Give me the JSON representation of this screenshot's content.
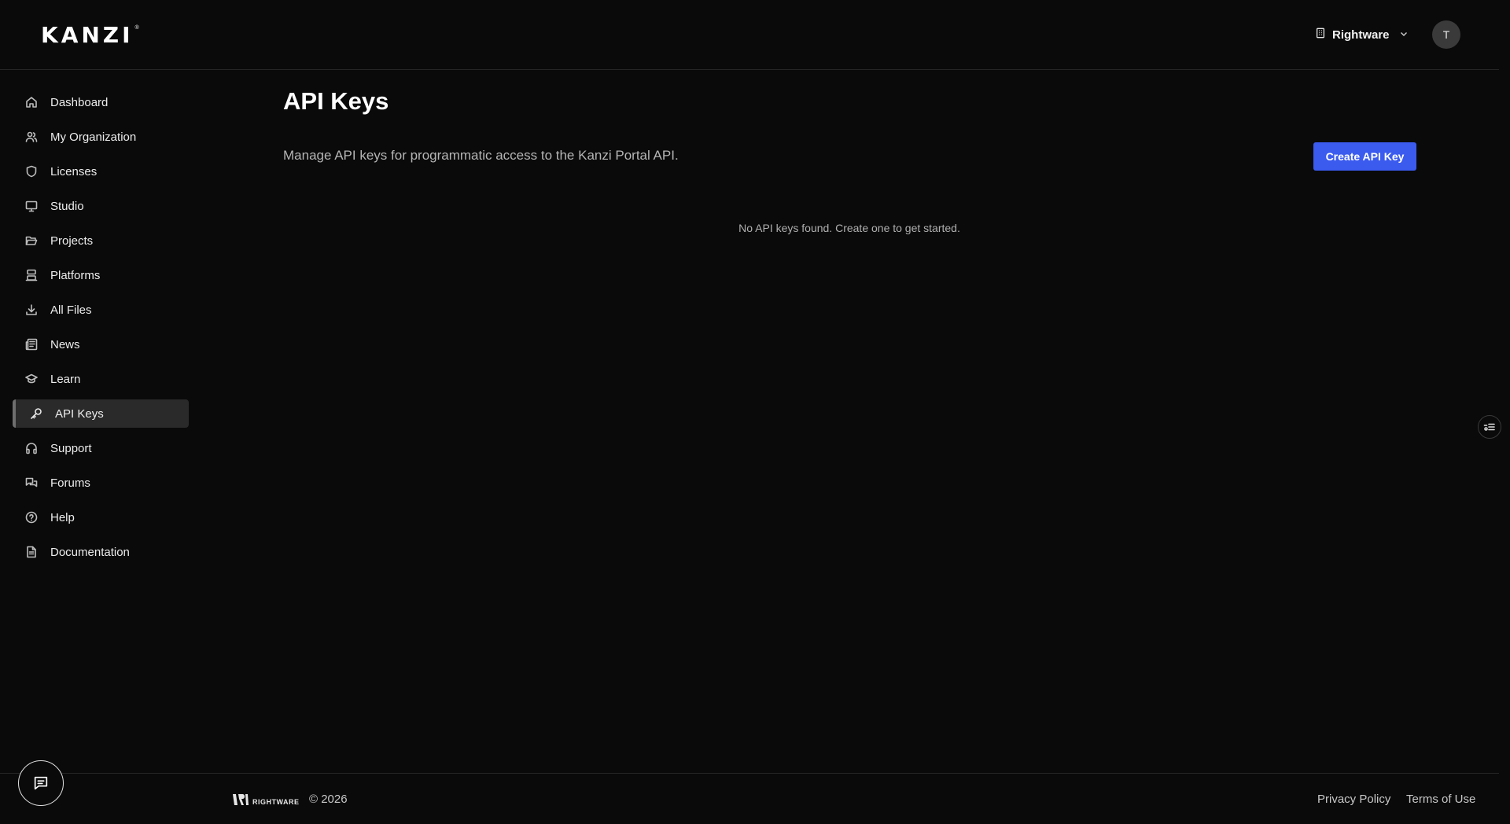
{
  "header": {
    "logo_text": "KANZI",
    "logo_reg": "®",
    "org_name": "Rightware",
    "avatar_initial": "T"
  },
  "sidebar": {
    "items": [
      {
        "label": "Dashboard",
        "icon": "home-icon"
      },
      {
        "label": "My Organization",
        "icon": "users-icon"
      },
      {
        "label": "Licenses",
        "icon": "shield-icon"
      },
      {
        "label": "Studio",
        "icon": "monitor-icon"
      },
      {
        "label": "Projects",
        "icon": "folder-open-icon"
      },
      {
        "label": "Platforms",
        "icon": "server-icon"
      },
      {
        "label": "All Files",
        "icon": "download-icon"
      },
      {
        "label": "News",
        "icon": "newspaper-icon"
      },
      {
        "label": "Learn",
        "icon": "graduation-cap-icon"
      },
      {
        "label": "API Keys",
        "icon": "key-icon",
        "active": true
      },
      {
        "label": "Support",
        "icon": "headphones-icon"
      },
      {
        "label": "Forums",
        "icon": "messages-icon"
      },
      {
        "label": "Help",
        "icon": "help-circle-icon"
      },
      {
        "label": "Documentation",
        "icon": "file-text-icon"
      }
    ]
  },
  "main": {
    "title": "API Keys",
    "description": "Manage API keys for programmatic access to the Kanzi Portal API.",
    "create_button_label": "Create API Key",
    "empty_message": "No API keys found. Create one to get started."
  },
  "footer": {
    "brand_word": "RIGHTWARE",
    "copyright": "© 2026",
    "privacy_label": "Privacy Policy",
    "terms_label": "Terms of Use"
  },
  "colors": {
    "background": "#0a0a0a",
    "accent": "#3b5bef",
    "active_nav_bg": "#2a2a2a"
  }
}
